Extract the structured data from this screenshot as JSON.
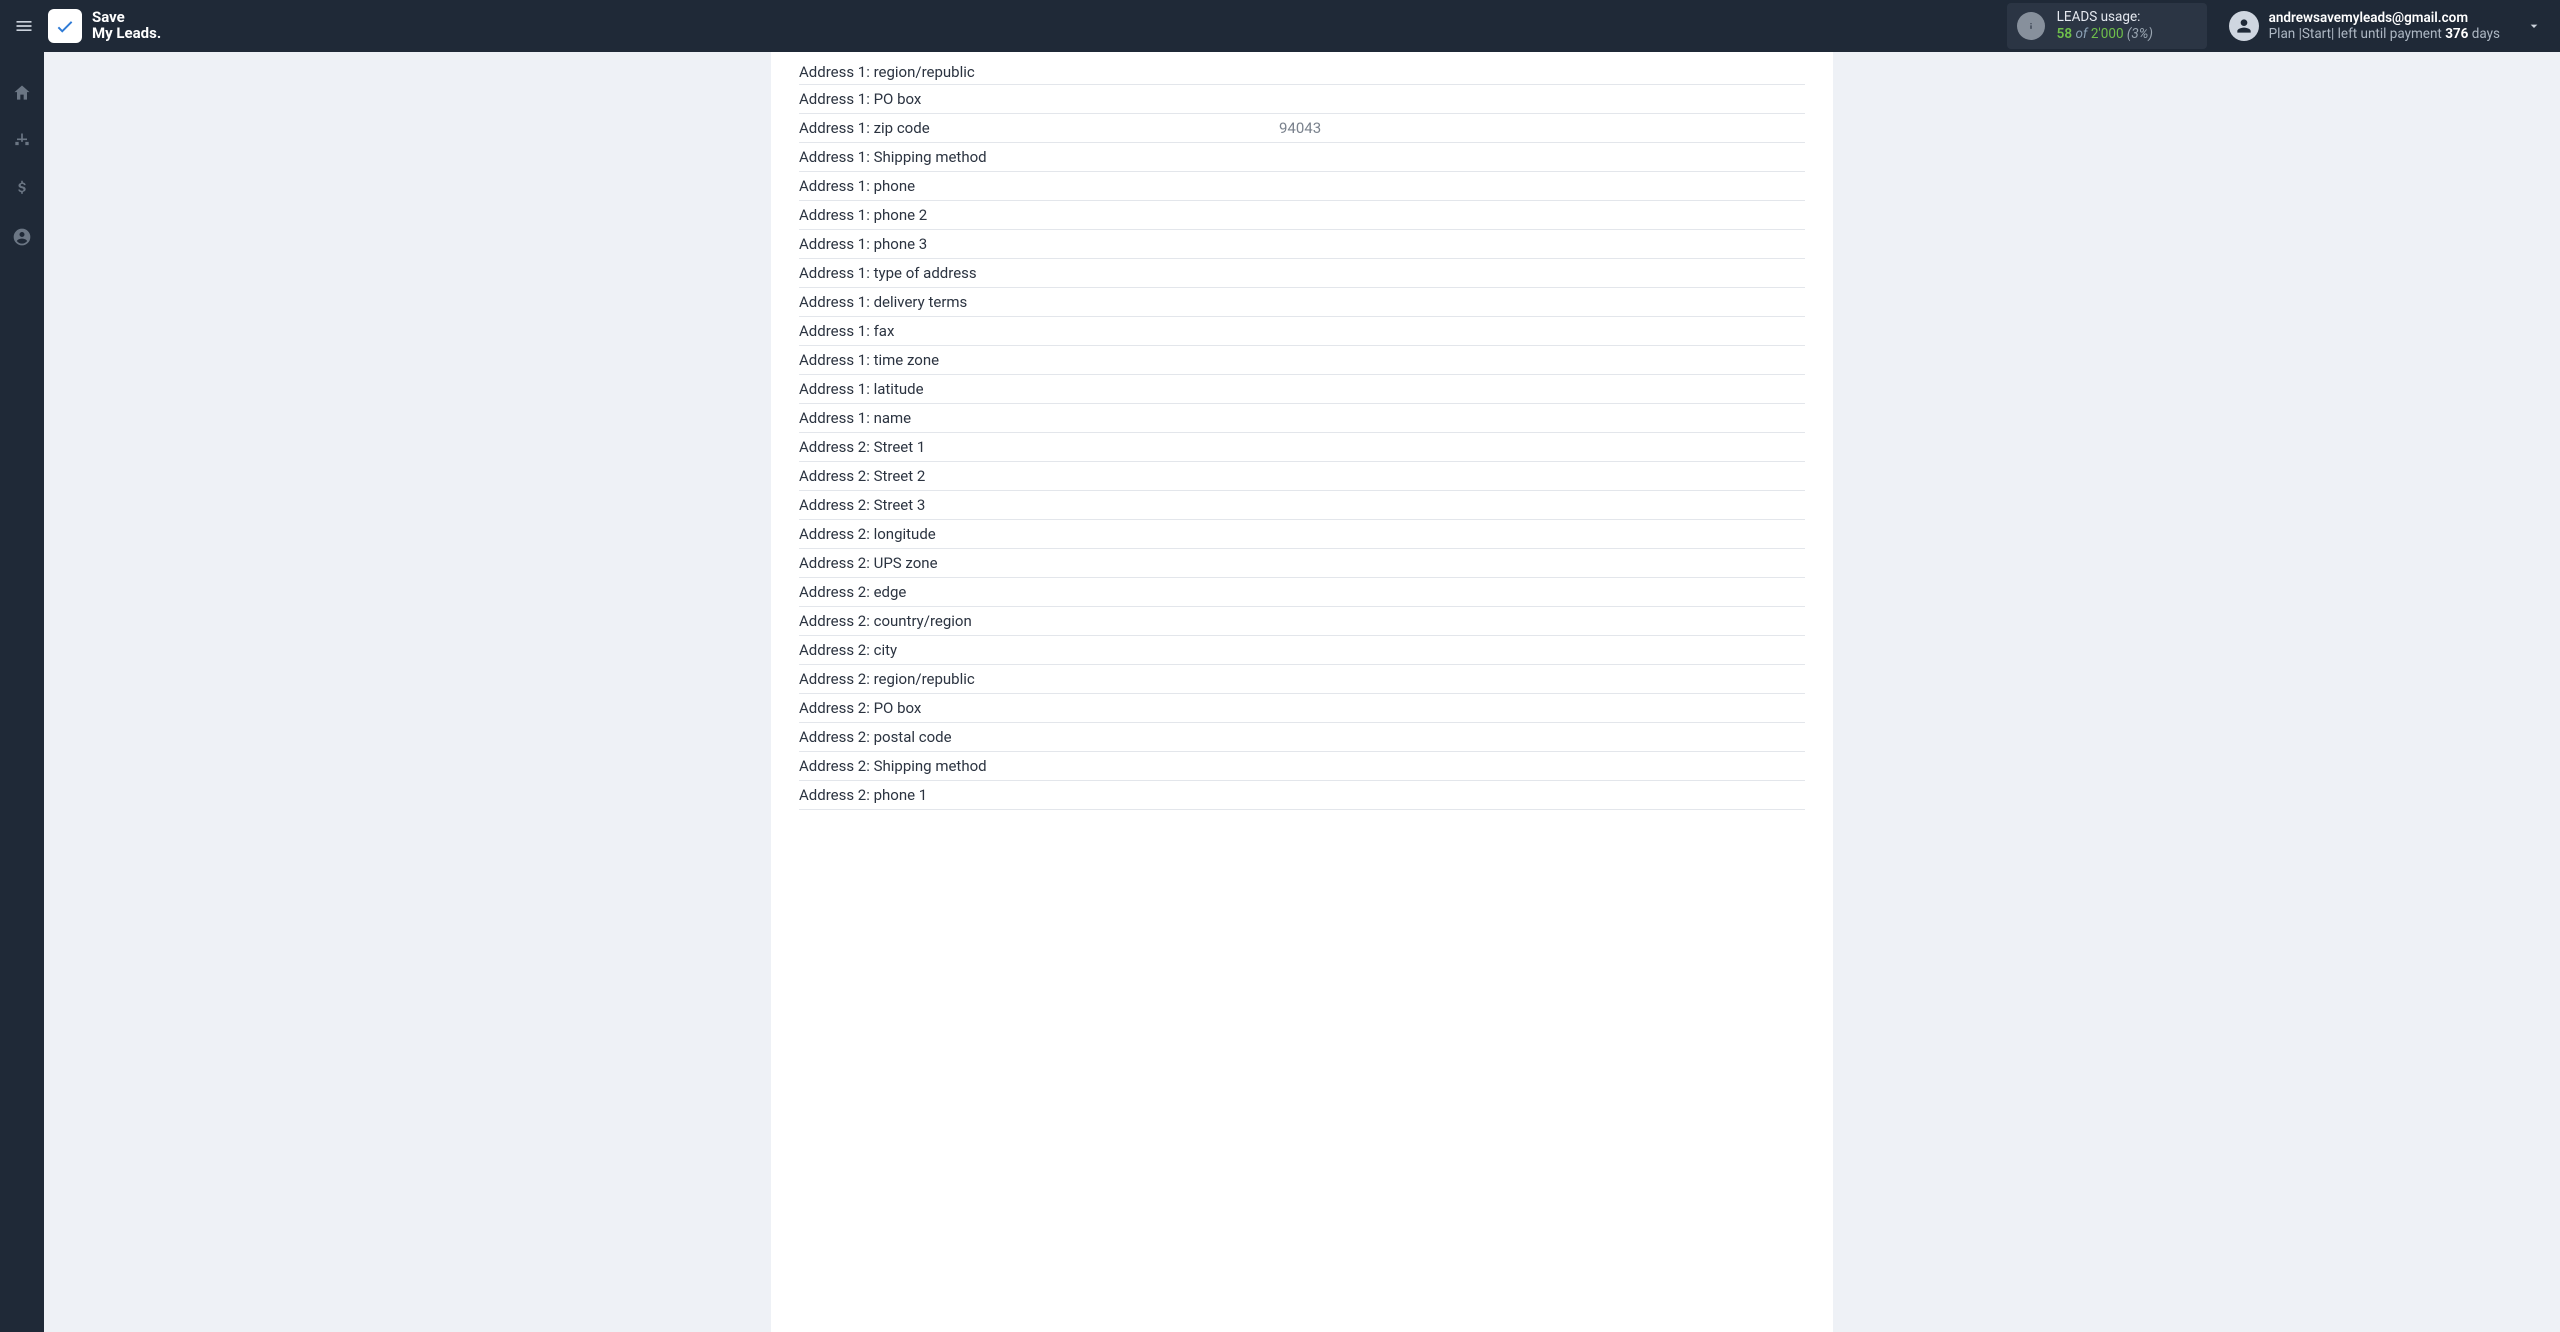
{
  "brand": {
    "line1": "Save",
    "line2": "My Leads"
  },
  "usage": {
    "label": "LEADS usage:",
    "used": "58",
    "of": "of",
    "total": "2'000",
    "percent": "(3%)"
  },
  "account": {
    "email": "andrewsavemyleads@gmail.com",
    "plan_prefix": "Plan |Start| left until payment ",
    "days": "376",
    "days_suffix": " days"
  },
  "fields": [
    {
      "label": "Address 1: region/republic",
      "value": ""
    },
    {
      "label": "Address 1: PO box",
      "value": ""
    },
    {
      "label": "Address 1: zip code",
      "value": "94043"
    },
    {
      "label": "Address 1: Shipping method",
      "value": ""
    },
    {
      "label": "Address 1: phone",
      "value": ""
    },
    {
      "label": "Address 1: phone 2",
      "value": ""
    },
    {
      "label": "Address 1: phone 3",
      "value": ""
    },
    {
      "label": "Address 1: type of address",
      "value": ""
    },
    {
      "label": "Address 1: delivery terms",
      "value": ""
    },
    {
      "label": "Address 1: fax",
      "value": ""
    },
    {
      "label": "Address 1: time zone",
      "value": ""
    },
    {
      "label": "Address 1: latitude",
      "value": ""
    },
    {
      "label": "Address 1: name",
      "value": ""
    },
    {
      "label": "Address 2: Street 1",
      "value": ""
    },
    {
      "label": "Address 2: Street 2",
      "value": ""
    },
    {
      "label": "Address 2: Street 3",
      "value": ""
    },
    {
      "label": "Address 2: longitude",
      "value": ""
    },
    {
      "label": "Address 2: UPS zone",
      "value": ""
    },
    {
      "label": "Address 2: edge",
      "value": ""
    },
    {
      "label": "Address 2: country/region",
      "value": ""
    },
    {
      "label": "Address 2: city",
      "value": ""
    },
    {
      "label": "Address 2: region/republic",
      "value": ""
    },
    {
      "label": "Address 2: PO box",
      "value": ""
    },
    {
      "label": "Address 2: postal code",
      "value": ""
    },
    {
      "label": "Address 2: Shipping method",
      "value": ""
    },
    {
      "label": "Address 2: phone 1",
      "value": ""
    }
  ]
}
